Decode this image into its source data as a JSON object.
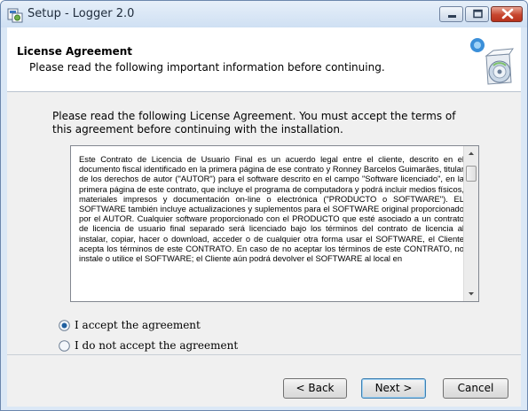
{
  "window": {
    "title": "Setup - Logger 2.0",
    "icon": "setup-installer-icon",
    "controls": [
      "minimize-icon",
      "maximize-icon",
      "close-icon"
    ]
  },
  "header": {
    "title": "License Agreement",
    "subtitle": "Please read the following important information before continuing.",
    "graphic": "setup-cd-graphic"
  },
  "main": {
    "intro": "Please read the following License Agreement. You must accept the terms of this agreement before continuing with the installation.",
    "license_text": "Este Contrato de Licencia de Usuario Final es un acuerdo legal entre el cliente, descrito en el documento fiscal identificado en la primera página de ese contrato y Ronney Barcelos Guimarães, titular de los derechos de autor (\"AUTOR\") para el software descrito en el campo \"Software licenciado\", en la primera página de este contrato, que incluye el programa de computadora y podrá incluir medios físicos, materiales impresos y documentación on-line o electrónica (\"PRODUCTO o SOFTWARE\"). EL SOFTWARE también incluye actualizaciones y suplementos para el SOFTWARE original proporcionado por el AUTOR. Cualquier software proporcionado con el PRODUCTO que esté asociado a un contrato de licencia de usuario final separado será licenciado bajo los términos del contrato de licencia al instalar, copiar, hacer o download, acceder o de cualquier otra forma usar el SOFTWARE, el Cliente acepta los términos de este CONTRATO. En caso de no aceptar los términos de este CONTRATO, no instale o utilice el SOFTWARE; el Cliente aún podrá devolver el SOFTWARE al local en",
    "options": [
      {
        "label": "I accept the agreement",
        "selected": true
      },
      {
        "label": "I do not accept the agreement",
        "selected": false
      }
    ]
  },
  "footer": {
    "back_label": "< Back",
    "next_label": "Next >",
    "cancel_label": "Cancel"
  },
  "colors": {
    "frame": "#dbe8f6",
    "close_button": "#c7462f",
    "default_button_border": "#3c7fb1",
    "radio_selected": "#1f5fa0"
  }
}
